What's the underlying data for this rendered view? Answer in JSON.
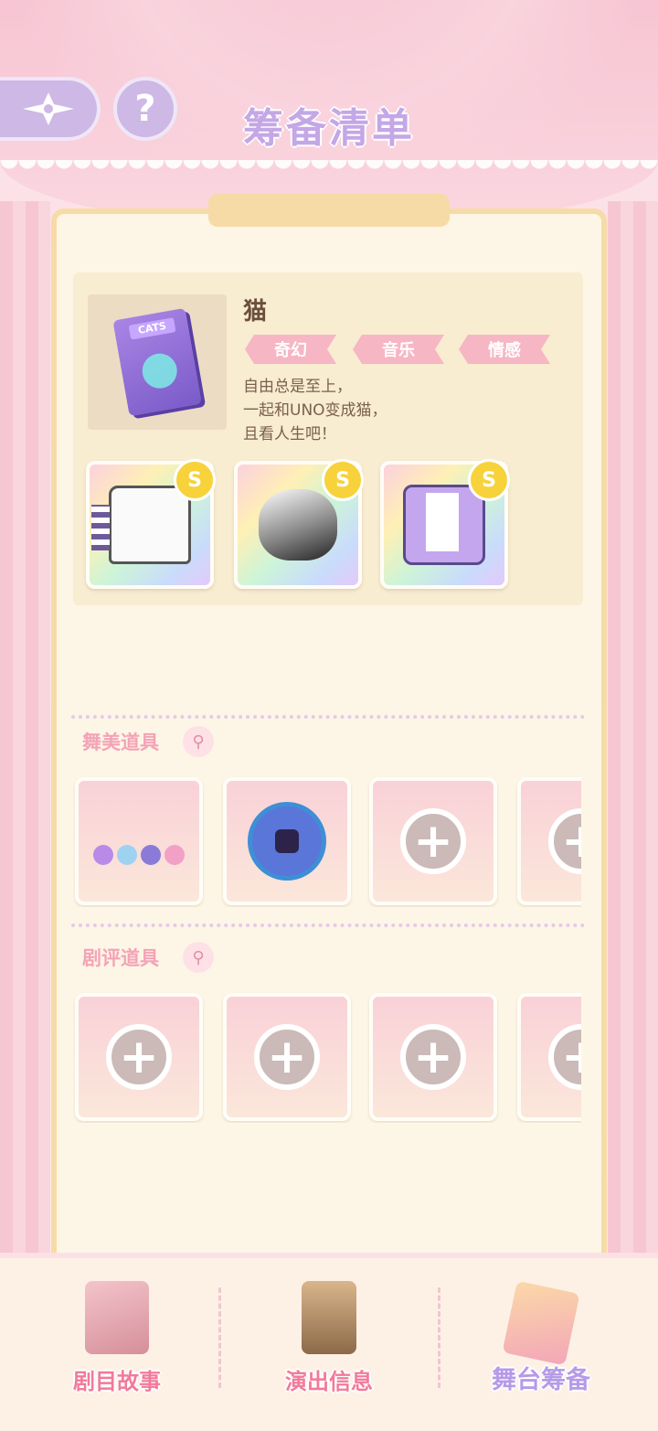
{
  "header": {
    "title": "筹备清单",
    "help_symbol": "?"
  },
  "story": {
    "name": "猫",
    "cover_text": "CATS",
    "tags": [
      "奇幻",
      "音乐",
      "情感"
    ],
    "description": [
      "自由总是至上，",
      "一起和UNO变成猫，",
      "且看人生吧！"
    ],
    "outfits": [
      {
        "badge": "S",
        "item": "shirt"
      },
      {
        "badge": "S",
        "item": "helmet"
      },
      {
        "badge": "S",
        "item": "jacket"
      }
    ]
  },
  "sections": {
    "stage_props": {
      "label": "舞美道具"
    },
    "review_props": {
      "label": "剧评道具"
    }
  },
  "slot_plus": "+",
  "bottom_nav": [
    {
      "label": "剧目故事",
      "active": false
    },
    {
      "label": "演出信息",
      "active": false
    },
    {
      "label": "舞台筹备",
      "active": true
    }
  ],
  "colors": {
    "accent_purple": "#c4a7e6",
    "tag_pink": "#f7b6c4",
    "nav_pink": "#f27a9a",
    "panel_bg": "#fdf6e6"
  }
}
